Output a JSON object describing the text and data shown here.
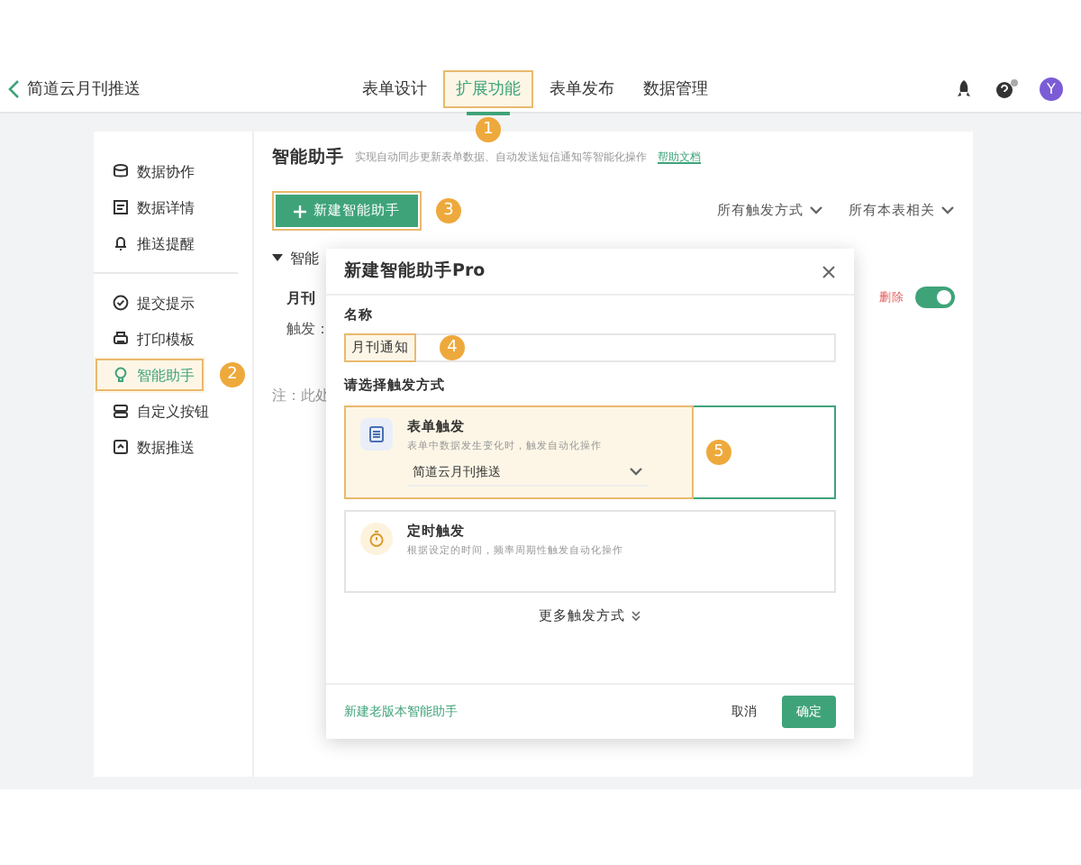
{
  "header": {
    "back_title": "简道云月刊推送",
    "tabs": [
      {
        "label": "表单设计",
        "selected": false
      },
      {
        "label": "扩展功能",
        "selected": true,
        "callout": "1"
      },
      {
        "label": "表单发布",
        "selected": false
      },
      {
        "label": "数据管理",
        "selected": false
      }
    ],
    "avatar": "Y"
  },
  "sidebar": {
    "groups": [
      [
        {
          "label": "数据协作",
          "kind": "db",
          "selected": false
        },
        {
          "label": "数据详情",
          "kind": "doc",
          "selected": false
        },
        {
          "label": "推送提醒",
          "kind": "bell",
          "selected": false
        }
      ],
      [
        {
          "label": "提交提示",
          "kind": "check",
          "selected": false
        },
        {
          "label": "打印模板",
          "kind": "print",
          "selected": false
        },
        {
          "label": "智能助手",
          "kind": "bulb",
          "selected": true,
          "callout": "2"
        },
        {
          "label": "自定义按钮",
          "kind": "btn",
          "selected": false
        },
        {
          "label": "数据推送",
          "kind": "push",
          "selected": false
        }
      ]
    ]
  },
  "main": {
    "title": "智能助手",
    "description": "实现自动同步更新表单数据、自动发送短信通知等智能化操作",
    "help_link": "帮助文档",
    "new_button": {
      "label": "新建智能助手",
      "callout": "3"
    },
    "filters": [
      "所有触发方式",
      "所有本表相关"
    ],
    "group_label": "智能",
    "item_name": "月刊",
    "item_trigger": "触发：",
    "delete_label": "删除",
    "enabled": true,
    "note": "注：此处"
  },
  "dialog": {
    "title": "新建智能助手Pro",
    "name_label": "名称",
    "name_value": "月刊通知",
    "name_callout": "4",
    "trigger_label": "请选择触发方式",
    "triggers": [
      {
        "kind": "form",
        "title": "表单触发",
        "description": "表单中数据发生变化时，触发自动化操作",
        "form_select": "简道云月刊推送",
        "selected": true,
        "callout": "5"
      },
      {
        "kind": "timer",
        "title": "定时触发",
        "description": "根据设定的时间，频率周期性触发自动化操作",
        "selected": false
      }
    ],
    "more": "更多触发方式",
    "legacy_link": "新建老版本智能助手",
    "cancel": "取消",
    "ok": "确定"
  }
}
